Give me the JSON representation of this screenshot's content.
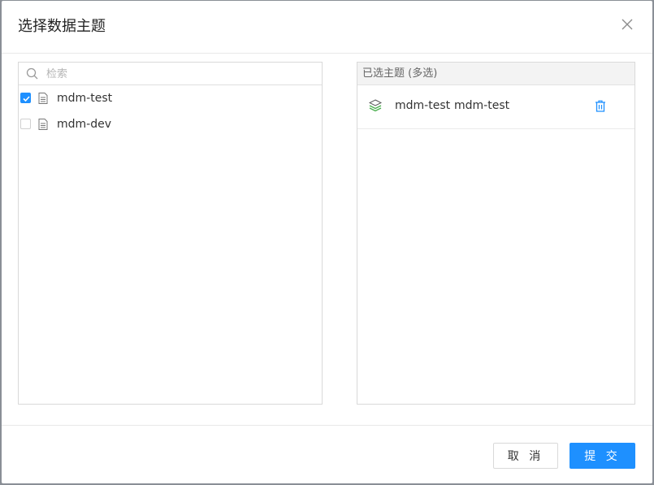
{
  "modal": {
    "title": "选择数据主题",
    "close_icon": "close-icon"
  },
  "left_panel": {
    "search": {
      "placeholder": "检索",
      "value": ""
    },
    "items": [
      {
        "label": "mdm-test",
        "checked": true,
        "icon": "document-icon"
      },
      {
        "label": "mdm-dev",
        "checked": false,
        "icon": "document-icon"
      }
    ]
  },
  "right_panel": {
    "header": "已选主题 (多选)",
    "selected": [
      {
        "name": "mdm-test",
        "alias": "mdm-test",
        "icon": "layers-icon",
        "action_icon": "trash-icon"
      }
    ]
  },
  "footer": {
    "cancel_label": "取 消",
    "submit_label": "提 交"
  },
  "colors": {
    "accent": "#1e90ff",
    "border": "#d9d9d9",
    "header_bg": "#f3f3f3",
    "layers_green": "#4caf50"
  }
}
